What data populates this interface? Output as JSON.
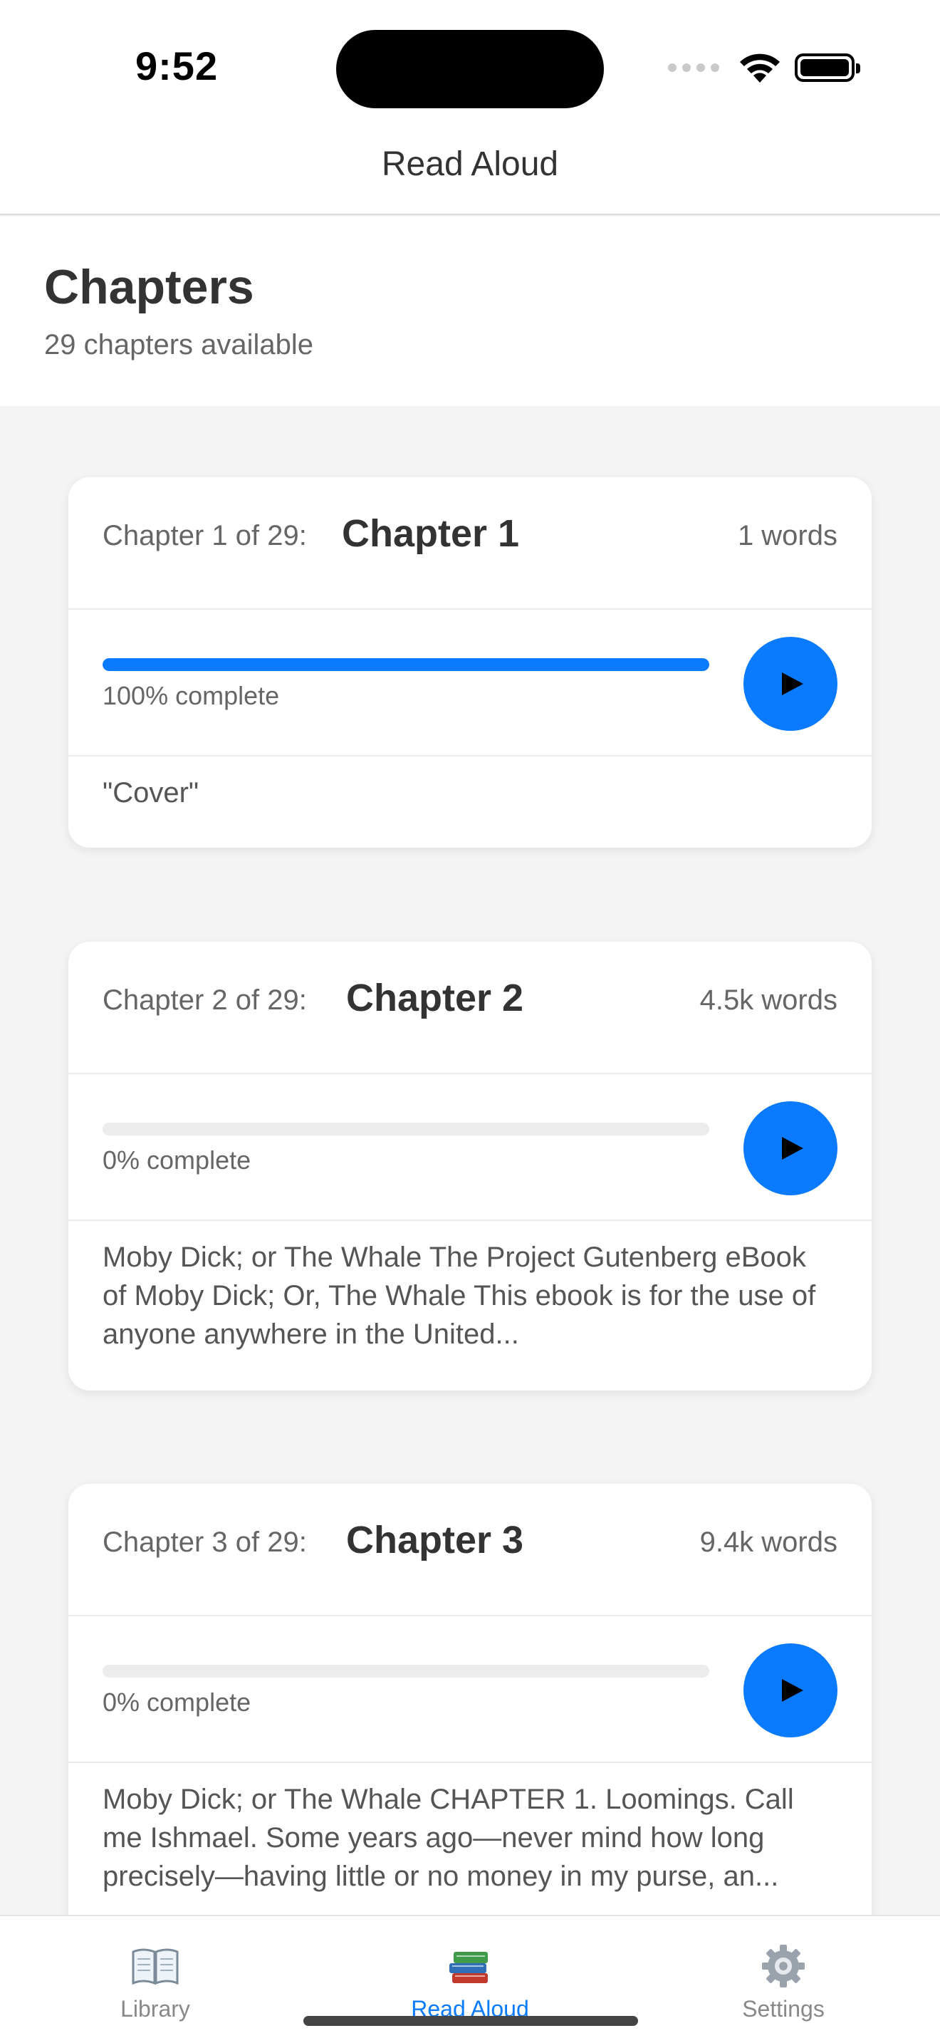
{
  "status_bar": {
    "time": "9:52"
  },
  "nav": {
    "title": "Read Aloud"
  },
  "header": {
    "title": "Chapters",
    "subtitle": "29 chapters available"
  },
  "chapters": [
    {
      "prefix": "Chapter 1 of 29:",
      "name": "Chapter 1",
      "words": "1 words",
      "progress_label": "100% complete",
      "progress": 1.0,
      "excerpt": "\"Cover\""
    },
    {
      "prefix": "Chapter 2 of 29:",
      "name": "Chapter 2",
      "words": "4.5k words",
      "progress_label": "0% complete",
      "progress": 0.0,
      "excerpt": "Moby Dick; or The Whale The Project Gutenberg eBook of Moby Dick; Or, The Whale This ebook is for the use of anyone anywhere in the United..."
    },
    {
      "prefix": "Chapter 3 of 29:",
      "name": "Chapter 3",
      "words": "9.4k words",
      "progress_label": "0% complete",
      "progress": 0.0,
      "excerpt": "Moby Dick; or The Whale CHAPTER 1. Loomings. Call me Ishmael. Some years ago—never mind how long precisely—having little or no money in my purse, an..."
    }
  ],
  "tabs": [
    {
      "label": "Library",
      "icon": "open-book-icon",
      "active": false
    },
    {
      "label": "Read Aloud",
      "icon": "books-stack-icon",
      "active": true
    },
    {
      "label": "Settings",
      "icon": "gear-icon",
      "active": false
    }
  ],
  "colors": {
    "accent": "#0a7aff",
    "background": "#f4f4f4",
    "card": "#ffffff",
    "text": "#333333",
    "muted": "#666666"
  }
}
